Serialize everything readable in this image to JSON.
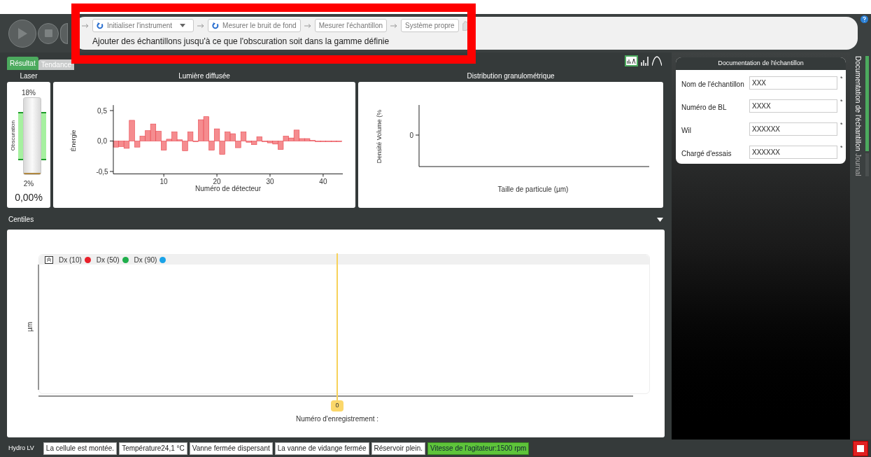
{
  "workflow": {
    "steps": [
      {
        "label": "Initialiser l'instrument",
        "kind": "menu"
      },
      {
        "label": "Mesurer le bruit de fond",
        "kind": "refresh"
      },
      {
        "label": "Mesurer l'échantillon",
        "kind": "plain"
      },
      {
        "label": "Système propre",
        "kind": "plain"
      }
    ],
    "instruction": "Ajouter des échantillons jusqu'à ce que l'obscuration soit dans la gamme définie"
  },
  "tabs": [
    {
      "label": "Résultat",
      "selected": true
    },
    {
      "label": "Tendance",
      "selected": false
    }
  ],
  "view_modes": [
    {
      "kind": "combined",
      "selected": true
    },
    {
      "kind": "bars",
      "selected": false
    },
    {
      "kind": "curve",
      "selected": false
    }
  ],
  "laser": {
    "title": "Laser",
    "max_label": "18%",
    "min_label": "2%",
    "axis_label": "Obscuration",
    "reading": "0,00%",
    "level": 0
  },
  "scattered_light": {
    "title": "Lumière diffusée",
    "chart_data": {
      "type": "bar",
      "xlabel": "Numéro de détecteur",
      "ylabel": "Énergie",
      "x": [
        1,
        2,
        3,
        4,
        5,
        6,
        7,
        8,
        9,
        10,
        11,
        12,
        13,
        14,
        15,
        16,
        17,
        18,
        19,
        20,
        21,
        22,
        23,
        24,
        25,
        26,
        27,
        28,
        29,
        30,
        31,
        32,
        33,
        34,
        35,
        36,
        37,
        38,
        39,
        40,
        41,
        42,
        43
      ],
      "values": [
        -0.1,
        -0.09,
        -0.12,
        0.34,
        -0.1,
        0.08,
        0.17,
        0.28,
        0.16,
        -0.15,
        0.03,
        0.15,
        0.02,
        -0.16,
        0.15,
        -0.01,
        0.35,
        0.4,
        -0.15,
        0.2,
        -0.22,
        0.15,
        0.12,
        -0.11,
        0.15,
        -0.02,
        -0.06,
        0.07,
        0,
        -0.03,
        -0.05,
        -0.14,
        0.08,
        0.05,
        0.18,
        0.04,
        0.04,
        0.01,
        0,
        0,
        0,
        0,
        0
      ],
      "xlim": [
        0.5,
        43.7
      ],
      "ylim": [
        -0.54,
        0.59
      ],
      "xticks": [
        10,
        20,
        30,
        40
      ],
      "yticks": [
        {
          "value": -0.5,
          "label": "-0,5"
        },
        {
          "value": 0,
          "label": "0,0"
        },
        {
          "value": 0.5,
          "label": "0,5"
        }
      ]
    }
  },
  "distribution": {
    "title": "Distribution granulométrique",
    "chart_data": {
      "type": "other",
      "xlabel": "Taille de particule (µm)",
      "ylabel": "Densité Volume (%"
    },
    "y_tick_label": "0"
  },
  "centiles": {
    "title": "Centiles",
    "chart_data": {
      "type": "other",
      "xlabel": "Numéro d'enregistrement :",
      "ylabel": "µm"
    },
    "legend": [
      {
        "label": "Dx (10)",
        "color": "#e8202a"
      },
      {
        "label": "Dx (50)",
        "color": "#1fae4b"
      },
      {
        "label": "Dx (90)",
        "color": "#1aa3e8"
      }
    ],
    "cursor_label": "0"
  },
  "documentation": {
    "title": "Documentation de l'échantillon",
    "fields": [
      {
        "label": "Nom de l'échantillon",
        "value": "XXX",
        "required_mark": "*"
      },
      {
        "label": "Numéro de BL",
        "value": "XXXX",
        "required_mark": "*"
      },
      {
        "label": "Wil",
        "value": "XXXXXX",
        "required_mark": "*"
      },
      {
        "label": "Chargé d'essais",
        "value": "XXXXXX",
        "required_mark": "*"
      }
    ]
  },
  "side_tabs": [
    {
      "label": "Documentation de l'échantillon",
      "selected": true
    },
    {
      "label": "Journal",
      "selected": false
    }
  ],
  "status_bar": {
    "device": "Hydro LV",
    "items": [
      {
        "text": "La cellule est montée.",
        "active": false
      },
      {
        "text": "Température24,1 °C",
        "active": false
      },
      {
        "text": "Vanne fermée dispersant",
        "active": false
      },
      {
        "text": "La vanne de vidange fermée",
        "active": false
      },
      {
        "text": "Réservoir plein.",
        "active": false
      },
      {
        "text": "Vitesse de l'agitateur:1500 rpm",
        "active": true
      }
    ]
  }
}
